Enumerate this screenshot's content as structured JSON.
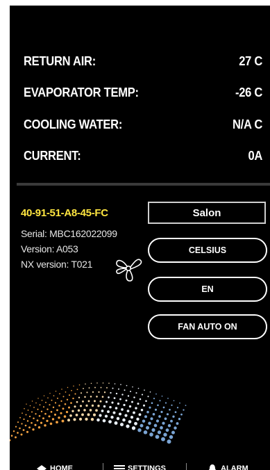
{
  "readings": [
    {
      "label": "RETURN AIR:",
      "value": "27 C"
    },
    {
      "label": "EVAPORATOR TEMP:",
      "value": "-26 C"
    },
    {
      "label": "COOLING WATER:",
      "value": "N/A C"
    },
    {
      "label": "CURRENT:",
      "value": "0A"
    }
  ],
  "device": {
    "id": "40-91-51-A8-45-FC",
    "serial": "Serial: MBC162022099",
    "version": "Version: A053",
    "nx_version": "NX version: T021"
  },
  "controls": {
    "location": "Salon",
    "units_button": "CELSIUS",
    "language_button": "EN",
    "fan_button": "FAN AUTO ON"
  },
  "nav": {
    "home": "HOME",
    "settings": "SETTINGS",
    "alarm": "ALARM"
  },
  "colors": {
    "background": "#000000",
    "device_id": "#ffe640",
    "text": "#ffffff"
  }
}
